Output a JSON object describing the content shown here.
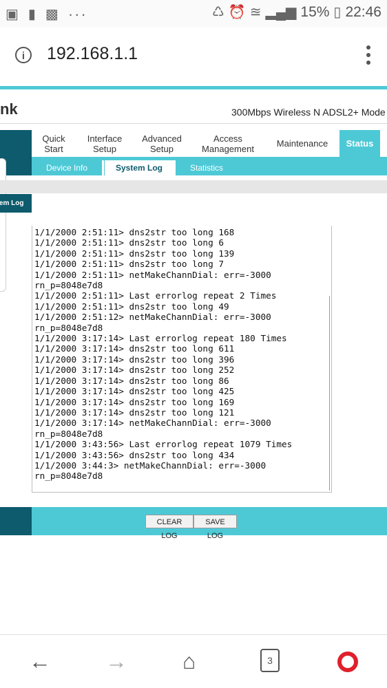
{
  "status_bar": {
    "battery_percent": "15%",
    "time": "22:46",
    "icons": [
      "image-icon",
      "alert-icon",
      "chat-icon",
      "more-icon",
      "battery-saver-icon",
      "alarm-icon",
      "wifi-icon",
      "signal-icon",
      "battery-icon"
    ]
  },
  "browser": {
    "url": "192.168.1.1",
    "tab_count": "3"
  },
  "router": {
    "brand_fragment": "nk",
    "model": "300Mbps Wireless N ADSL2+ Mode",
    "nav": [
      {
        "line1": "Quick",
        "line2": "Start"
      },
      {
        "line1": "Interface",
        "line2": "Setup"
      },
      {
        "line1": "Advanced",
        "line2": "Setup"
      },
      {
        "line1": "Access",
        "line2": "Management"
      },
      {
        "line1": "Maintenance",
        "line2": ""
      },
      {
        "line1": "Status",
        "line2": ""
      }
    ],
    "subnav": [
      "Device Info",
      "System Log",
      "Statistics"
    ],
    "side_label": "stem Log",
    "log_lines": [
      "1/1/2000 2:51:11> dns2str too long 168",
      "1/1/2000 2:51:11> dns2str too long 6",
      "1/1/2000 2:51:11> dns2str too long 139",
      "1/1/2000 2:51:11> dns2str too long 7",
      "1/1/2000 2:51:11> netMakeChannDial: err=-3000",
      "rn_p=8048e7d8",
      "1/1/2000 2:51:11> Last errorlog repeat 2 Times",
      "1/1/2000 2:51:11> dns2str too long 49",
      "1/1/2000 2:51:12> netMakeChannDial: err=-3000",
      "rn_p=8048e7d8",
      "1/1/2000 3:17:14> Last errorlog repeat 180 Times",
      "1/1/2000 3:17:14> dns2str too long 611",
      "1/1/2000 3:17:14> dns2str too long 396",
      "1/1/2000 3:17:14> dns2str too long 252",
      "1/1/2000 3:17:14> dns2str too long 86",
      "1/1/2000 3:17:14> dns2str too long 425",
      "1/1/2000 3:17:14> dns2str too long 169",
      "1/1/2000 3:17:14> dns2str too long 121",
      "1/1/2000 3:17:14> netMakeChannDial: err=-3000",
      "rn_p=8048e7d8",
      "1/1/2000 3:43:56> Last errorlog repeat 1079 Times",
      "1/1/2000 3:43:56> dns2str too long 434",
      "1/1/2000 3:44:3> netMakeChannDial: err=-3000",
      "rn_p=8048e7d8"
    ],
    "buttons": {
      "clear_log": "CLEAR LOG",
      "save_log": "SAVE LOG"
    }
  },
  "colors": {
    "teal": "#4dc9d6",
    "dark_teal": "#0d5b6d",
    "opera_red": "#e0202c"
  }
}
